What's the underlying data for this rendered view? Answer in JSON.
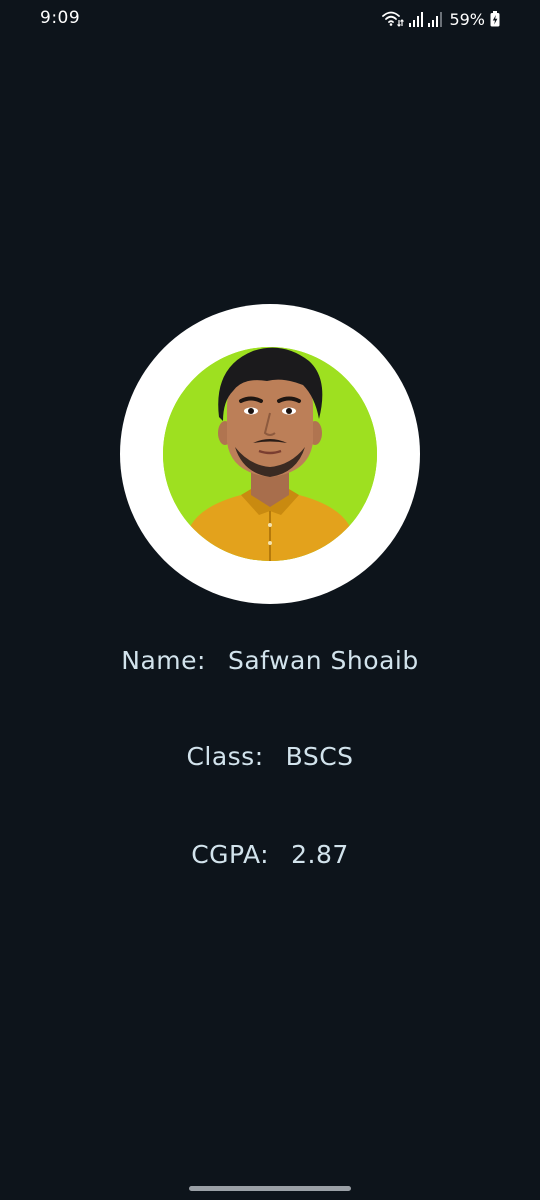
{
  "status_bar": {
    "time": "9:09",
    "battery_percent": "59%",
    "icons": [
      "wifi-icon",
      "signal-icon",
      "signal-icon",
      "battery-charging-icon"
    ]
  },
  "profile": {
    "avatar": {
      "description_icon": "profile-photo",
      "ring_color": "#ffffff",
      "background_color": "#9ee020"
    },
    "name_label": "Name:",
    "name_value": "Safwan Shoaib",
    "class_label": "Class:",
    "class_value": "BSCS",
    "cgpa_label": "CGPA:",
    "cgpa_value": "2.87"
  },
  "colors": {
    "background": "#0d141b",
    "text": "#d2e3ec"
  }
}
